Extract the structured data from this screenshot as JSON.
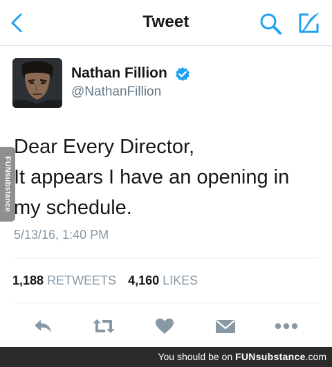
{
  "header": {
    "title": "Tweet",
    "back_icon": "chevron-left-icon",
    "search_icon": "search-icon",
    "compose_icon": "compose-icon",
    "accent_color": "#1da1f2"
  },
  "author": {
    "name": "Nathan Fillion",
    "handle": "@NathanFillion",
    "verified": true
  },
  "tweet": {
    "lines": [
      "Dear Every Director,",
      "It appears I have an opening in",
      "my schedule."
    ],
    "timestamp": "5/13/16, 1:40 PM"
  },
  "stats": {
    "retweets_count": "1,188",
    "retweets_label": "RETWEETS",
    "likes_count": "4,160",
    "likes_label": "LIKES"
  },
  "actions": {
    "icons": [
      "reply-icon",
      "retweet-icon",
      "like-icon",
      "message-icon",
      "more-icon"
    ],
    "color": "#8899a6"
  },
  "watermark": {
    "side_text": "FUNsubstance",
    "footer_prefix": "You should be on",
    "footer_brand": "FUNsubstance",
    "footer_domain": ".com"
  }
}
